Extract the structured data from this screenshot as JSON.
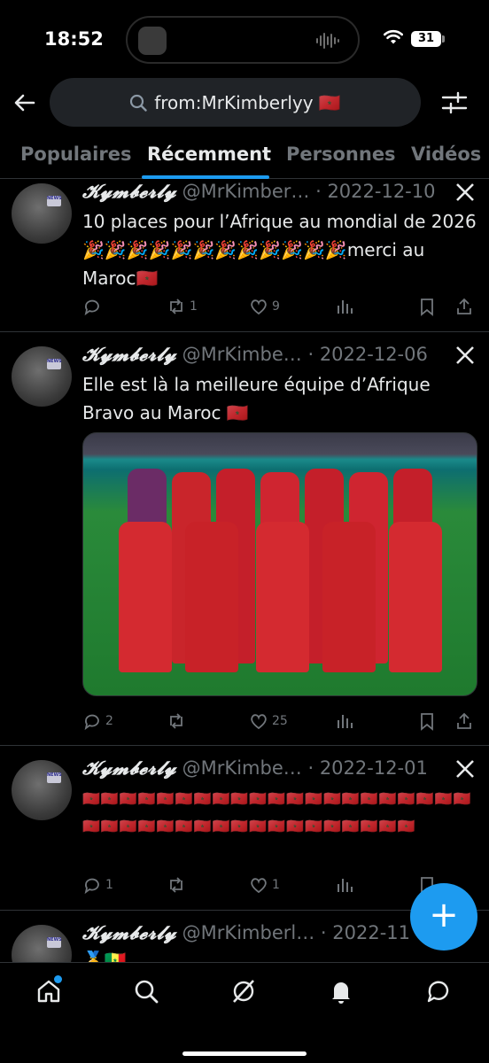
{
  "status_bar": {
    "time": "18:52",
    "battery": "31"
  },
  "search": {
    "query": "from:MrKimberlyy 🇲🇦"
  },
  "tabs": [
    {
      "label": "Populaires"
    },
    {
      "label": "Récemment",
      "active": true
    },
    {
      "label": "Personnes"
    },
    {
      "label": "Vidéos"
    }
  ],
  "tweets": [
    {
      "name": "𝓚𝔂𝓶𝓫𝓮𝓻𝓵𝔂",
      "handle": "@MrKimber…",
      "dot": "·",
      "date": "2022-12-10",
      "text": "10 places pour l’Afrique au mondial de 2026 🎉🎉🎉🎉🎉🎉🎉🎉🎉🎉🎉🎉merci au Maroc🇲🇦",
      "reply_count": "",
      "retweet_count": "1",
      "like_count": "9"
    },
    {
      "name": "𝓚𝔂𝓶𝓫𝓮𝓻𝓵𝔂",
      "handle": "@MrKimbe…",
      "dot": "·",
      "date": "2022-12-06",
      "text": "Elle est là la meilleure équipe d’Afrique Bravo au Maroc 🇲🇦",
      "reply_count": "2",
      "retweet_count": "",
      "like_count": "25"
    },
    {
      "name": "𝓚𝔂𝓶𝓫𝓮𝓻𝓵𝔂",
      "handle": "@MrKimbe…",
      "dot": "·",
      "date": "2022-12-01",
      "text": "🇲🇦🇲🇦🇲🇦🇲🇦🇲🇦🇲🇦🇲🇦🇲🇦🇲🇦🇲🇦🇲🇦🇲🇦🇲🇦🇲🇦🇲🇦🇲🇦🇲🇦🇲🇦🇲🇦🇲🇦🇲🇦🇲🇦🇲🇦🇲🇦🇲🇦🇲🇦🇲🇦🇲🇦🇲🇦🇲🇦🇲🇦🇲🇦🇲🇦🇲🇦🇲🇦🇲🇦🇲🇦🇲🇦🇲🇦",
      "reply_count": "1",
      "retweet_count": "",
      "like_count": "1"
    },
    {
      "name": "𝓚𝔂𝓶𝓫𝓮𝓻𝓵𝔂",
      "handle": "@MrKimberl…",
      "dot": "·",
      "date": "2022-11",
      "text": "🥇🇸🇳"
    }
  ],
  "colors": {
    "accent": "#1d9bf0",
    "background": "#000000",
    "muted": "#71767b"
  }
}
